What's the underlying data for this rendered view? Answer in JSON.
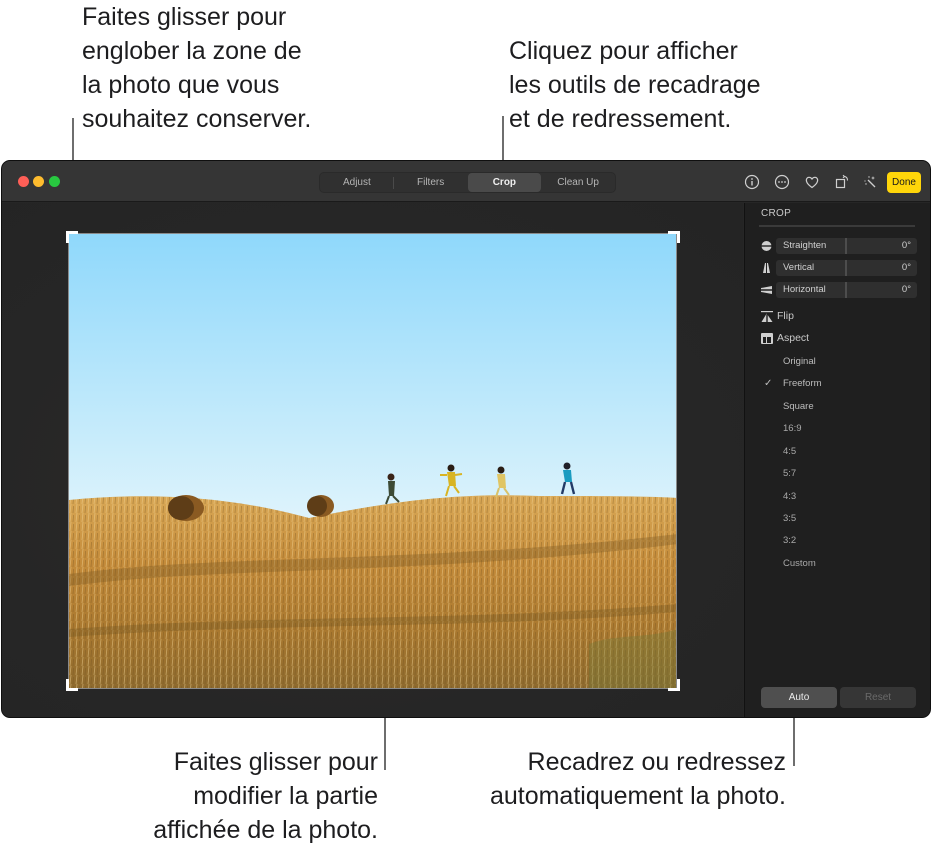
{
  "callouts": {
    "top_left": [
      "Faites glisser pour",
      "englober la zone de",
      "la photo que vous",
      "souhaitez conserver."
    ],
    "top_right": [
      "Cliquez pour afficher",
      "les outils de recadrage",
      "et de redressement."
    ],
    "bottom_center": [
      "Faites glisser pour",
      "modifier la partie",
      "affichée de la photo."
    ],
    "bottom_right": [
      "Recadrez ou redressez",
      "automatiquement la photo."
    ]
  },
  "window": {
    "traffic_lights": [
      "close",
      "minimize",
      "zoom"
    ],
    "tabs": [
      {
        "label": "Adjust",
        "active": false
      },
      {
        "label": "Filters",
        "active": false
      },
      {
        "label": "Crop",
        "active": true
      },
      {
        "label": "Clean Up",
        "active": false
      }
    ],
    "toolbar_icons": [
      "info-icon",
      "more-icon",
      "heart-icon",
      "rotate-icon",
      "magic-wand-icon"
    ],
    "done_label": "Done",
    "accent_color": "#ffd60a"
  },
  "sidebar": {
    "title": "CROP",
    "sliders": [
      {
        "label": "Straighten",
        "value": "0°",
        "icon": "straighten-icon"
      },
      {
        "label": "Vertical",
        "value": "0°",
        "icon": "vertical-perspective-icon"
      },
      {
        "label": "Horizontal",
        "value": "0°",
        "icon": "horizontal-perspective-icon"
      }
    ],
    "flip_label": "Flip",
    "aspect_label": "Aspect",
    "aspect_options": [
      {
        "label": "Original",
        "selected": false
      },
      {
        "label": "Freeform",
        "selected": true
      },
      {
        "label": "Square",
        "selected": false
      },
      {
        "label": "16:9",
        "selected": false
      },
      {
        "label": "4:5",
        "selected": false
      },
      {
        "label": "5:7",
        "selected": false
      },
      {
        "label": "4:3",
        "selected": false
      },
      {
        "label": "3:5",
        "selected": false
      },
      {
        "label": "3:2",
        "selected": false
      },
      {
        "label": "Custom",
        "selected": false
      }
    ],
    "check_mark": "✓",
    "auto_label": "Auto",
    "reset_label": "Reset"
  }
}
